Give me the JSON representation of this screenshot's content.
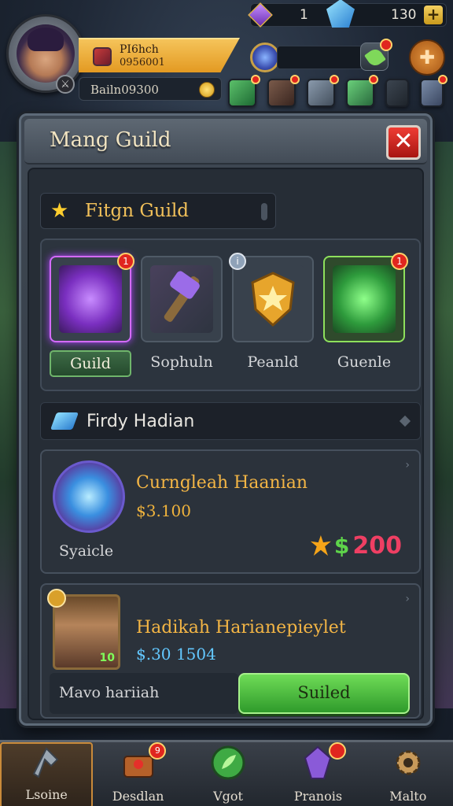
{
  "hud": {
    "player_line1": "PI6hch",
    "player_line2": "0956001",
    "player_sub": "Bailn09300",
    "resource_1": "1",
    "resource_2": "130",
    "plus_label": "+"
  },
  "panel": {
    "title": "Mang Guild",
    "close_label": "✕"
  },
  "section": {
    "label": "Fitgn Guild"
  },
  "tabs": [
    {
      "label": "Guild",
      "active": true
    },
    {
      "label": "Sophuln",
      "active": false
    },
    {
      "label": "Peanld",
      "active": false
    },
    {
      "label": "Guenle",
      "active": false
    }
  ],
  "subsection": {
    "label": "Firdy Hadian"
  },
  "cards": [
    {
      "title": "Curngleah Haanian",
      "price": "$3.100",
      "subtext": "Syaicle",
      "reward_amount": "200"
    },
    {
      "title": "Hadikah Harianepieylet",
      "price": "$.30 1504",
      "subtext": "Mavo hariiah",
      "button_label": "Suiled",
      "thumb_badge": "10"
    }
  ],
  "badges": {
    "tab1": "1",
    "tab4": "1",
    "nav2": "9"
  },
  "nav": [
    {
      "label": "Lsoine",
      "icon": "axe-icon",
      "active": true
    },
    {
      "label": "Desdlan",
      "icon": "chest-icon",
      "active": false
    },
    {
      "label": "Vgot",
      "icon": "leaf-orb-icon",
      "active": false
    },
    {
      "label": "Pranois",
      "icon": "crystal-icon",
      "active": false
    },
    {
      "label": "Malto",
      "icon": "gear-icon",
      "active": false
    }
  ],
  "colors": {
    "accent_gold": "#f2c15a",
    "active_green": "#6fdc57",
    "close_red": "#ef3d34",
    "reward_pink": "#ef3f63"
  }
}
